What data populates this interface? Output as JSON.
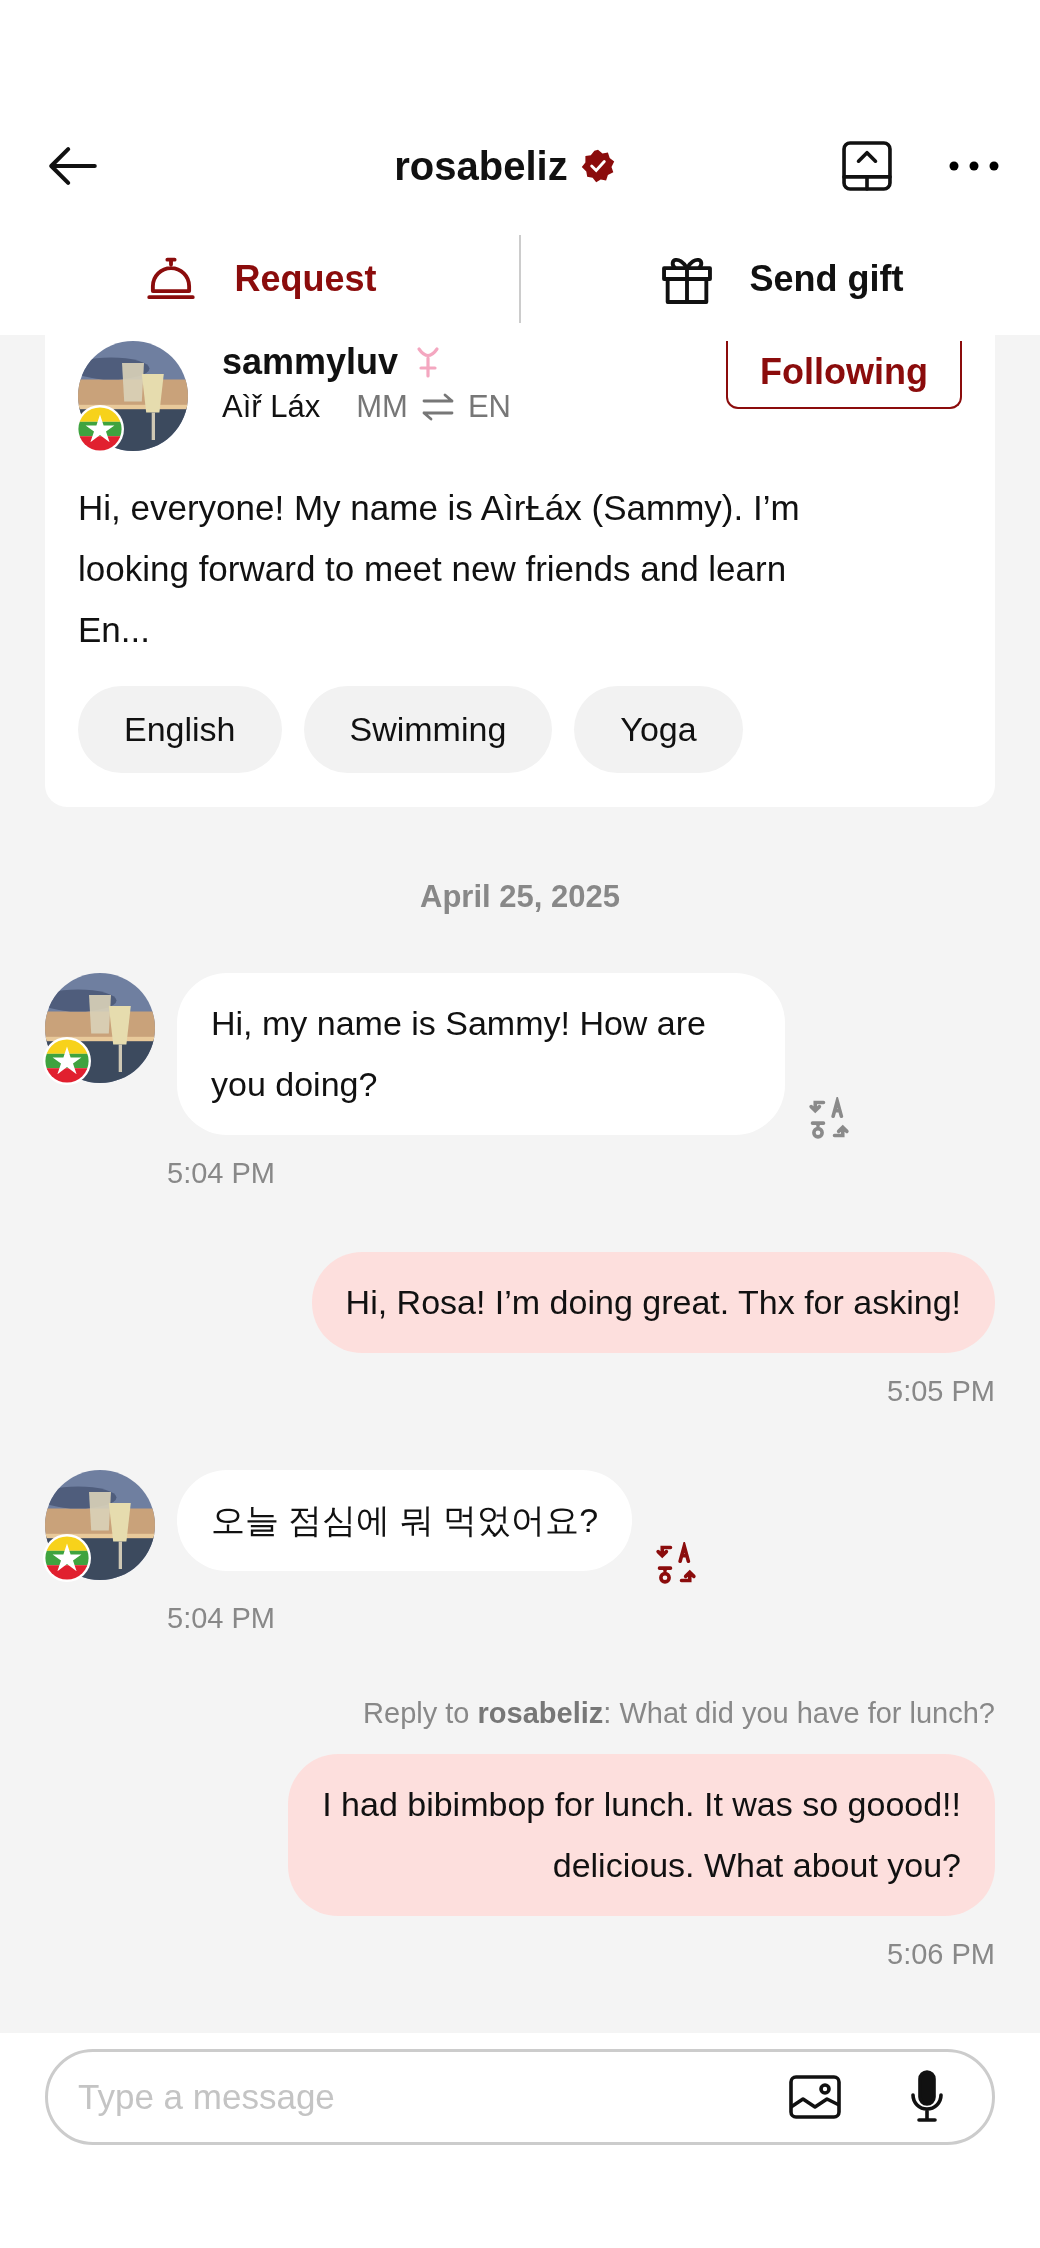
{
  "header": {
    "title": "rosabeliz",
    "verified": true
  },
  "actions": [
    {
      "kind": "request",
      "label": "Request",
      "selected": true
    },
    {
      "kind": "gift",
      "label": "Send gift",
      "selected": false
    }
  ],
  "profile": {
    "name": "sammyluv",
    "local_name": "Aìř Láx",
    "native": "MM",
    "learning": "EN",
    "follow_label": "Following",
    "bio": "Hi, everyone! My name is AìrȽáx (Sammy). I’m looking forward to meet new friends and learn En...",
    "tags": [
      "English",
      "Swimming",
      "Yoga"
    ]
  },
  "chat": [
    {
      "kind": "date",
      "text": "April 25, 2025"
    },
    {
      "kind": "incoming",
      "text": "Hi, my name is Sammy! How are you doing?",
      "time": "5:04 PM",
      "translated": false
    },
    {
      "kind": "outgoing",
      "text": "Hi, Rosa! I’m doing great. Thx for asking!",
      "time": "5:05 PM"
    },
    {
      "kind": "incoming",
      "text": "오늘 점심에 뭐 먹었어요?",
      "time": "5:04 PM",
      "translated": true
    },
    {
      "kind": "outgoing",
      "reply": "Reply to **rosabeliz**: What did you have for lunch?",
      "text": "I had bibimbop for lunch. It was so goood!!\ndelicious. What about you?",
      "time": "5:06 PM"
    }
  ],
  "composer": {
    "placeholder": "Type a message"
  }
}
